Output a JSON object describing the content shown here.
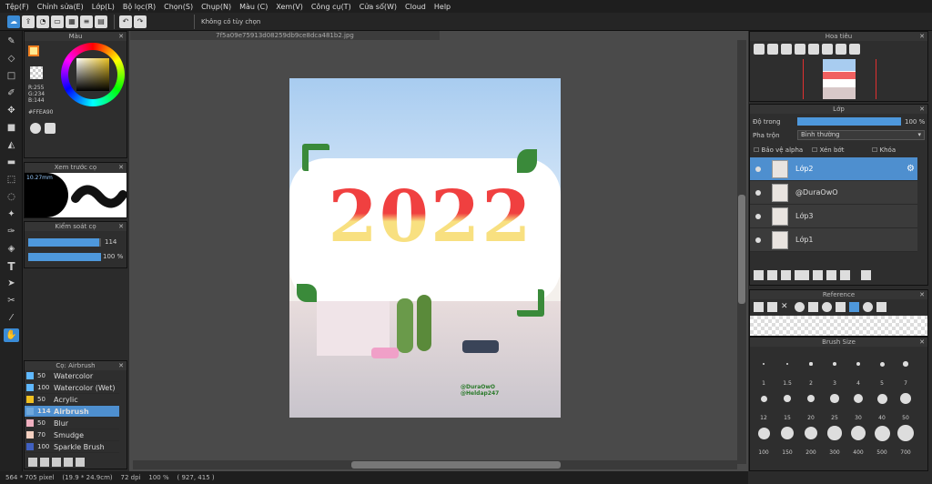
{
  "menu": [
    "Tệp(F)",
    "Chỉnh sửa(E)",
    "Lớp(L)",
    "Bộ lọc(R)",
    "Chọn(S)",
    "Chụp(N)",
    "Màu (C)",
    "Xem(V)",
    "Công cụ(T)",
    "Cửa sổ(W)",
    "Cloud",
    "Help"
  ],
  "toolbar": {
    "selection_text": "Không có tùy chọn"
  },
  "color_panel": {
    "title": "Màu",
    "r": "R:255",
    "g": "G:234",
    "b": "B:144",
    "hex": "#FFEA90",
    "fg": "#FFEA90"
  },
  "preview_panel": {
    "title": "Xem trước cọ",
    "size": "10.27mm"
  },
  "brush_control": {
    "title": "Kiểm soát cọ",
    "size": "114",
    "size_fill": 0.97,
    "opacity": "100 %",
    "opacity_fill": 1.0
  },
  "brush_list": {
    "title": "Cọ: Airbrush",
    "items": [
      {
        "n": "50",
        "name": "Watercolor",
        "color": "#5fb8ff"
      },
      {
        "n": "100",
        "name": "Watercolor (Wet)",
        "color": "#5fb8ff"
      },
      {
        "n": "50",
        "name": "Acrylic",
        "color": "#f0c020"
      },
      {
        "n": "114",
        "name": "Airbrush",
        "color": "#6fa8dc"
      },
      {
        "n": "50",
        "name": "Blur",
        "color": "#f0b0c0"
      },
      {
        "n": "70",
        "name": "Smudge",
        "color": "#f4d0c0"
      },
      {
        "n": "100",
        "name": "Sparkle Brush",
        "color": "#4060c0"
      }
    ]
  },
  "document": {
    "tab": "7f5a09e75913d08259db9ce8dca481b2.jpg",
    "year": "2022",
    "tag1": "@DuraOwO",
    "tag2": "@Heldap247"
  },
  "status": "564 * 705 pixel    (19.9 * 24.9cm)    72 dpi    100 %    ( 927, 415 )",
  "navigator": {
    "title": "Hoa tiêu"
  },
  "layer_panel": {
    "title": "Lớp",
    "opacity_label": "Độ trong",
    "opacity_value": "100 %",
    "opacity_fill": 1.0,
    "blend_label": "Pha trộn",
    "blend_value": "Bình thường",
    "protect_alpha": "Bảo vệ alpha",
    "clip": "Xén bớt",
    "lock": "Khóa",
    "layers": [
      {
        "name": "Lớp2",
        "selected": true
      },
      {
        "name": "@DuraOwO",
        "selected": false
      },
      {
        "name": "Lớp3",
        "selected": false
      },
      {
        "name": "Lớp1",
        "selected": false
      }
    ]
  },
  "reference_panel": {
    "title": "Reference"
  },
  "brush_size_panel": {
    "title": "Brush Size",
    "sizes": [
      "1",
      "1.5",
      "2",
      "3",
      "4",
      "5",
      "7",
      "12",
      "15",
      "20",
      "25",
      "30",
      "40",
      "50",
      "100",
      "150",
      "200",
      "300",
      "400",
      "500",
      "700"
    ]
  }
}
